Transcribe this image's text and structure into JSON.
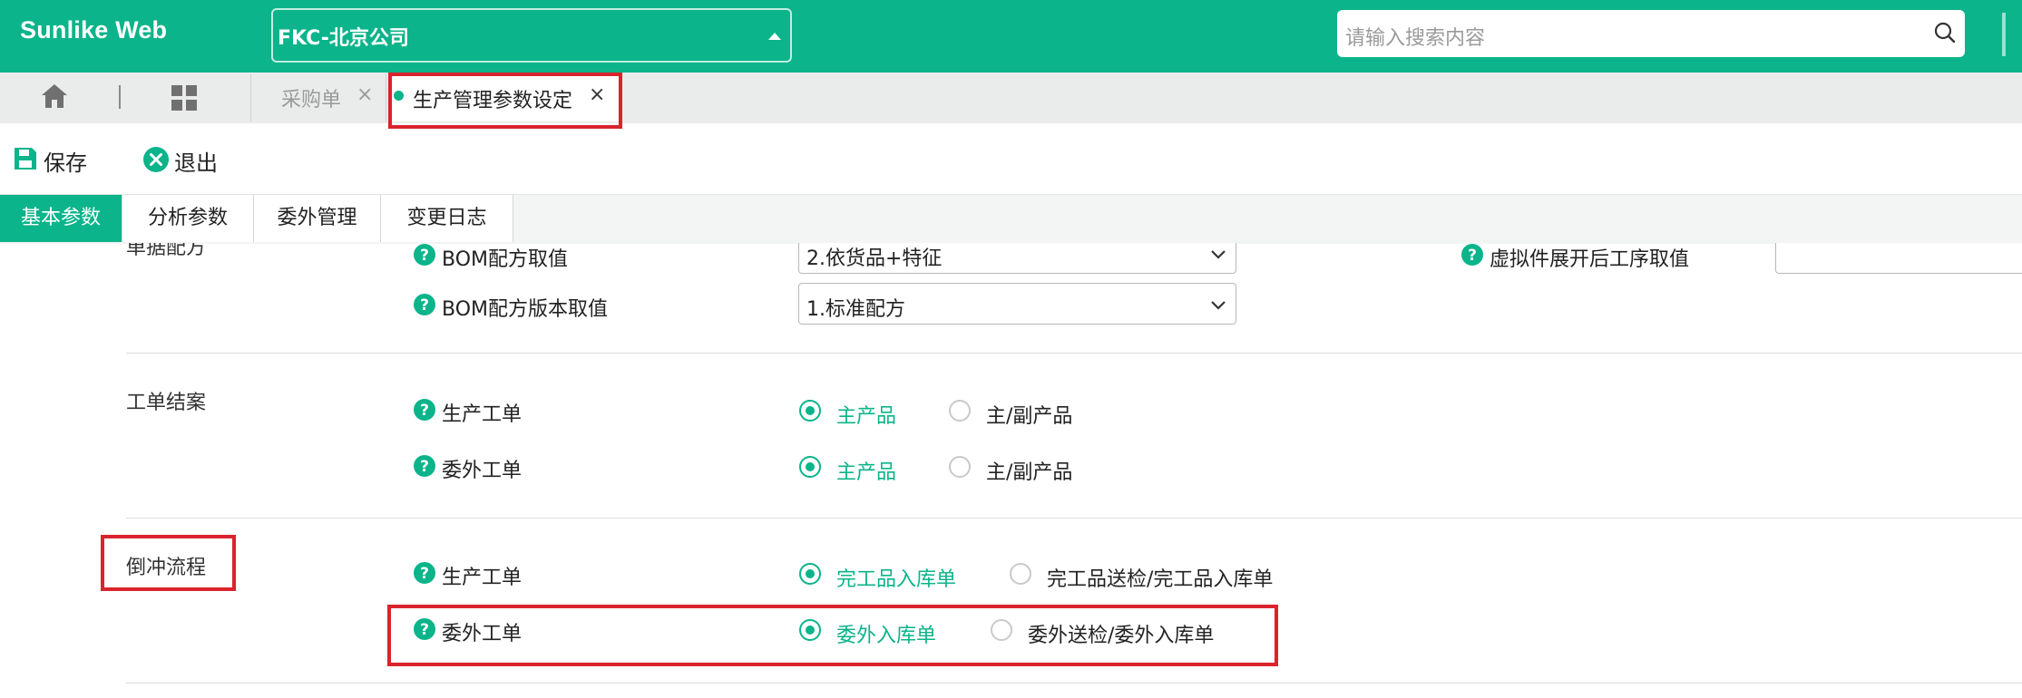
{
  "header": {
    "brand": "Sunlike Web",
    "company": "FKC-北京公司",
    "search_placeholder": "请输入搜索内容",
    "brand_color": "#0bb48a"
  },
  "tabs": {
    "items": [
      {
        "label": "采购单",
        "close": "×"
      },
      {
        "label": "生产管理参数设定",
        "close": "×"
      }
    ]
  },
  "toolbar": {
    "save_label": "保存",
    "exit_label": "退出"
  },
  "subtabs": [
    "基本参数",
    "分析参数",
    "委外管理",
    "变更日志"
  ],
  "sections": {
    "bom": {
      "title": "单据配方",
      "rows": [
        {
          "label": "BOM配方取值",
          "value": "2.依货品+特征"
        },
        {
          "label": "BOM配方版本取值",
          "value": "1.标准配方"
        }
      ],
      "right_label": "虚拟件展开后工序取值"
    },
    "close": {
      "title": "工单结案",
      "rows": [
        {
          "label": "生产工单",
          "options": [
            "主产品",
            "主/副产品"
          ],
          "selected": 0
        },
        {
          "label": "委外工单",
          "options": [
            "主产品",
            "主/副产品"
          ],
          "selected": 0
        }
      ]
    },
    "backflush": {
      "title": "倒冲流程",
      "rows": [
        {
          "label": "生产工单",
          "options": [
            "完工品入库单",
            "完工品送检/完工品入库单"
          ],
          "selected": 0
        },
        {
          "label": "委外工单",
          "options": [
            "委外入库单",
            "委外送检/委外入库单"
          ],
          "selected": 0
        }
      ]
    }
  },
  "colors": {
    "accent": "#0bb48a",
    "highlight": "#d9232d"
  }
}
